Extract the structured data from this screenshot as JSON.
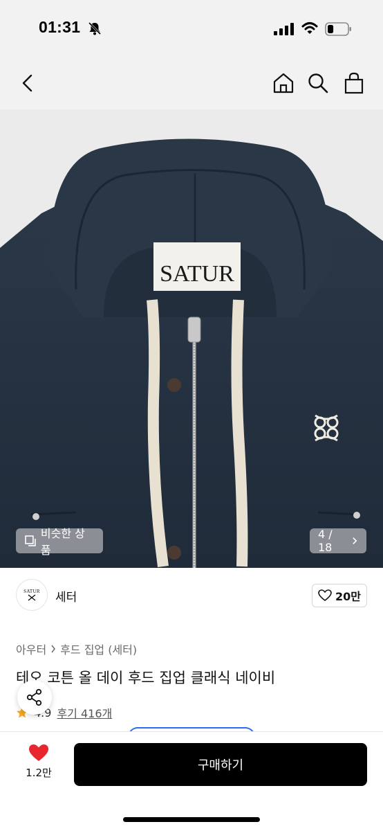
{
  "status_bar": {
    "time": "01:31",
    "battery_level": 0.3
  },
  "nav": {
    "icons": [
      "back-icon",
      "home-icon",
      "search-icon",
      "shopping-bag-icon"
    ]
  },
  "product_image": {
    "tag_text": "SATUR",
    "colors": {
      "fabric": "#263343",
      "cord": "#e8e1d2"
    }
  },
  "overlays": {
    "similar_label": "비슷한 상품",
    "counter_text": "4 / 18"
  },
  "brand": {
    "logo_text": "SATUR",
    "name": "세터"
  },
  "likes": {
    "count": "20만"
  },
  "breadcrumb": {
    "category": "아우터",
    "sub_category": "후드 집업 (세터)"
  },
  "product": {
    "title": "테오 코튼 올 데이 후드 집업 클래식 네이비",
    "rating": "4.9",
    "reviews": "후기 416개"
  },
  "bottom_bar": {
    "wish_count": "1.2만",
    "buy_label": "구매하기"
  },
  "colors": {
    "accent_red": "#e8262e",
    "star": "#f5a623",
    "buy_button": "#000000"
  }
}
